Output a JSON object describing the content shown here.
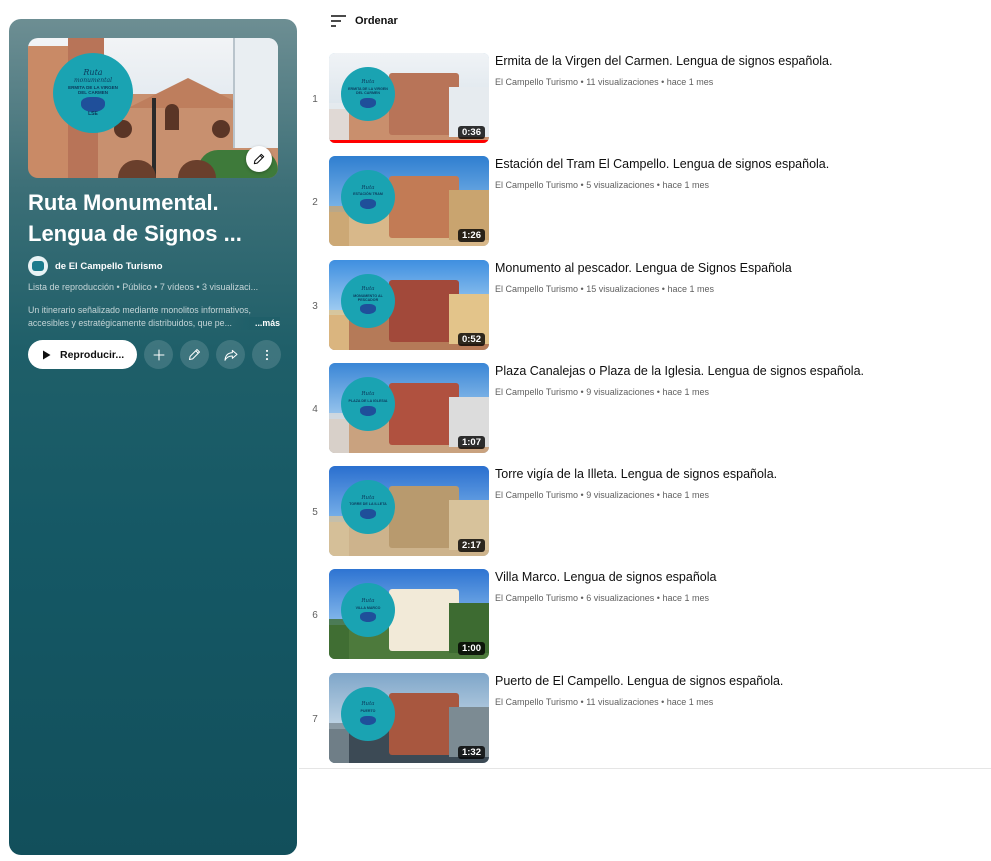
{
  "playlist": {
    "title": "Ruta Monumental. Lengua de Signos ...",
    "owner": "de El Campello Turismo",
    "meta": "Lista de reproducción • Público • 7 vídeos • 3 visualizaci...",
    "description": "Un itinerario señalizado mediante monolitos informativos, accesibles y estratégicamente distribuidos, que pe...",
    "more_label": "...más",
    "play_label": "Reproducir...",
    "cover_badge": {
      "line1": "Ruta",
      "line2": "monumental",
      "line3": "ERMITA DE LA VIRGEN DEL CARMEN",
      "line4": "LSE"
    }
  },
  "sort_label": "Ordenar",
  "videos": [
    {
      "index": "1",
      "title": "Ermita de la Virgen del Carmen. Lengua de signos española.",
      "channel": "El Campello Turismo",
      "views": "11 visualizaciones",
      "age": "hace 1 mes",
      "duration": "0:36",
      "badge": "ERMITA DE LA VIRGEN DEL CARMEN",
      "watched": true
    },
    {
      "index": "2",
      "title": "Estación del Tram El Campello. Lengua de signos española.",
      "channel": "El Campello Turismo",
      "views": "5 visualizaciones",
      "age": "hace 1 mes",
      "duration": "1:26",
      "badge": "ESTACIÓN TRAM"
    },
    {
      "index": "3",
      "title": "Monumento al pescador. Lengua de Signos Española",
      "channel": "El Campello Turismo",
      "views": "15 visualizaciones",
      "age": "hace 1 mes",
      "duration": "0:52",
      "badge": "MONUMENTO AL PESCADOR"
    },
    {
      "index": "4",
      "title": "Plaza Canalejas o Plaza de la Iglesia. Lengua de signos española.",
      "channel": "El Campello Turismo",
      "views": "9 visualizaciones",
      "age": "hace 1 mes",
      "duration": "1:07",
      "badge": "PLAZA DE LA IGLESIA"
    },
    {
      "index": "5",
      "title": "Torre vigía de la Illeta. Lengua de signos española.",
      "channel": "El Campello Turismo",
      "views": "9 visualizaciones",
      "age": "hace 1 mes",
      "duration": "2:17",
      "badge": "TORRE DE LA ILLETA"
    },
    {
      "index": "6",
      "title": "Villa Marco. Lengua de signos española",
      "channel": "El Campello Turismo",
      "views": "6 visualizaciones",
      "age": "hace 1 mes",
      "duration": "1:00",
      "badge": "VILLA MARCO"
    },
    {
      "index": "7",
      "title": "Puerto de El Campello. Lengua de signos española.",
      "channel": "El Campello Turismo",
      "views": "11 visualizaciones",
      "age": "hace 1 mes",
      "duration": "1:32",
      "badge": "PUERTO"
    }
  ],
  "separator": "•",
  "colors": {
    "panel": "#155865",
    "badge": "#1aa3b2",
    "progress": "#ff0000"
  },
  "icons": [
    "pencil-icon",
    "play-icon",
    "plus-icon",
    "share-icon",
    "more-vert-icon",
    "sort-icon"
  ]
}
